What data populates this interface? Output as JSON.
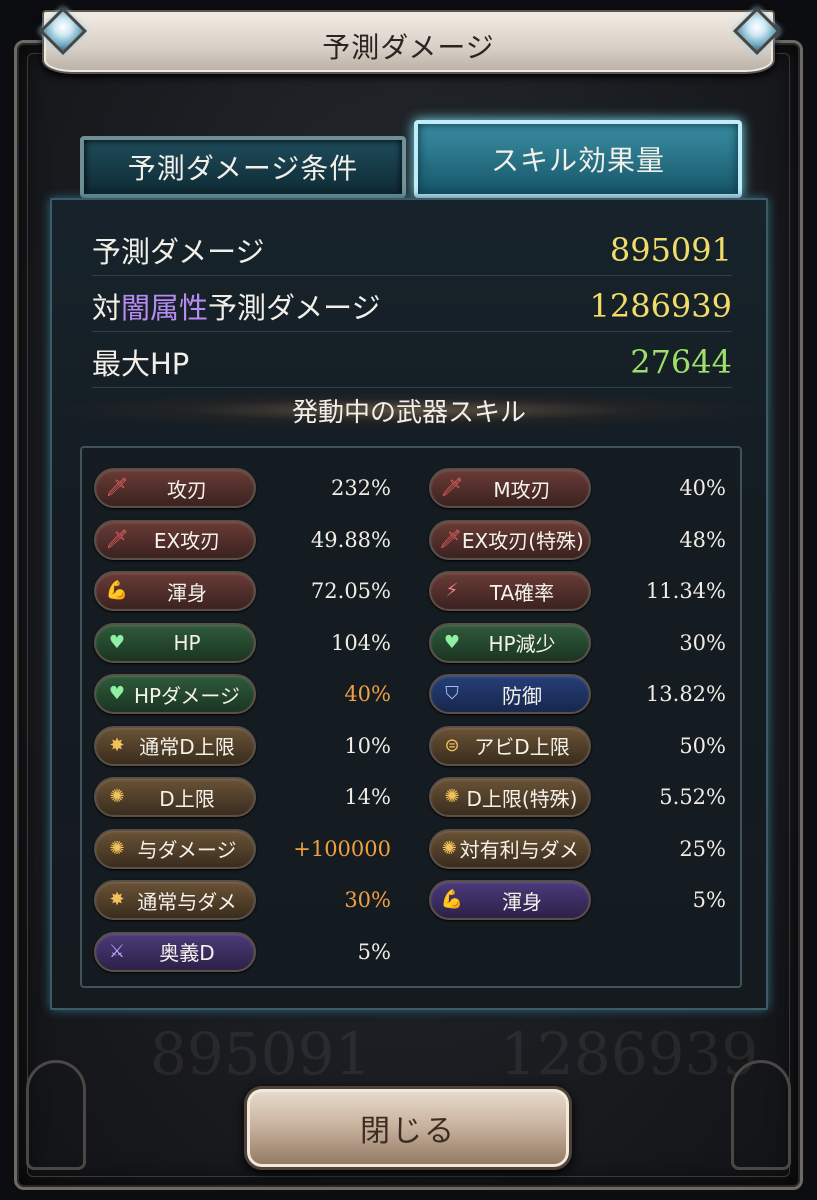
{
  "header": {
    "title": "予測ダメージ"
  },
  "tabs": [
    {
      "label": "予測ダメージ条件"
    },
    {
      "label": "スキル効果量"
    }
  ],
  "stats": {
    "damage": {
      "label": "予測ダメージ",
      "value": "895091",
      "color": "#f1dc6a"
    },
    "vs_dark": {
      "label_prefix": "対",
      "label_element": "闇属性",
      "label_suffix": "予測ダメージ",
      "value": "1286939",
      "color": "#f1dc6a",
      "element_color": "#b78cf2"
    },
    "max_hp": {
      "label": "最大HP",
      "value": "27644",
      "color": "#9ee06a"
    }
  },
  "skills_section": {
    "title": "発動中の武器スキル"
  },
  "skills": [
    {
      "name": "攻刃",
      "value": "232%",
      "icon": "sword-icon",
      "style": "red"
    },
    {
      "name": "M攻刃",
      "value": "40%",
      "icon": "sword-icon",
      "style": "red"
    },
    {
      "name": "EX攻刃",
      "value": "49.88%",
      "icon": "sword-icon",
      "style": "red"
    },
    {
      "name": "EX攻刃(特殊)",
      "value": "48%",
      "icon": "sword-icon",
      "style": "red"
    },
    {
      "name": "渾身",
      "value": "72.05%",
      "icon": "flex-arm-icon",
      "style": "red"
    },
    {
      "name": "TA確率",
      "value": "11.34%",
      "icon": "triple-slash-icon",
      "style": "red"
    },
    {
      "name": "HP",
      "value": "104%",
      "icon": "heart-icon",
      "style": "green"
    },
    {
      "name": "HP減少",
      "value": "30%",
      "icon": "heart-icon",
      "style": "green"
    },
    {
      "name": "HPダメージ",
      "value": "40%",
      "icon": "heart-icon",
      "style": "green",
      "value_color": "#f0a040"
    },
    {
      "name": "防御",
      "value": "13.82%",
      "icon": "shield-icon",
      "style": "blue"
    },
    {
      "name": "通常D上限",
      "value": "10%",
      "icon": "burst-icon",
      "style": "brown"
    },
    {
      "name": "アビD上限",
      "value": "50%",
      "icon": "striped-circle-icon",
      "style": "brown"
    },
    {
      "name": "D上限",
      "value": "14%",
      "icon": "sun-ring-icon",
      "style": "brown"
    },
    {
      "name": "D上限(特殊)",
      "value": "5.52%",
      "icon": "sun-ring-icon",
      "style": "brown"
    },
    {
      "name": "与ダメージ",
      "value": "+100000",
      "icon": "sun-ring-icon",
      "style": "brown",
      "value_color": "#f0a040"
    },
    {
      "name": "対有利与ダメ",
      "value": "25%",
      "icon": "sun-ring-icon",
      "style": "brown"
    },
    {
      "name": "通常与ダメ",
      "value": "30%",
      "icon": "burst-icon",
      "style": "brown",
      "value_color": "#f0a040"
    },
    {
      "name": "渾身",
      "value": "5%",
      "icon": "flex-arm-icon",
      "style": "purple"
    },
    {
      "name": "奥義D",
      "value": "5%",
      "icon": "crossed-swords-icon",
      "style": "purple"
    }
  ],
  "close_button": {
    "label": "閉じる"
  }
}
